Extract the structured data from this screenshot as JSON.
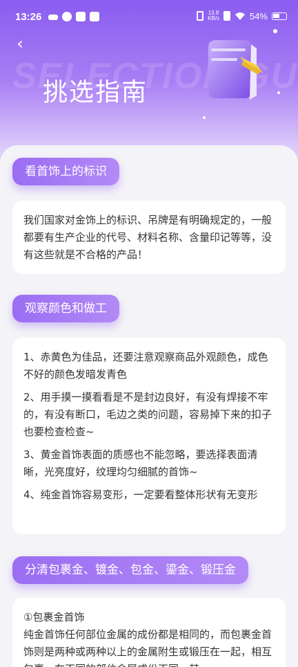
{
  "status": {
    "time": "13:26",
    "speed": "13.8",
    "speed_unit": "KB/s",
    "battery": "54%"
  },
  "header": {
    "back": "‹",
    "bg_word": "SELECTION GUIDE",
    "title": "挑选指南"
  },
  "sections": [
    {
      "tag": "看首饰上的标识",
      "paragraphs": [
        "我们国家对金饰上的标识、吊牌是有明确规定的，一般都要有生产企业的代号、材料名称、含量印记等等，没有这些就是不合格的产品！"
      ]
    },
    {
      "tag": "观察颜色和做工",
      "paragraphs": [
        "1、赤黄色为佳品，还要注意观察商品外观颜色，成色不好的颜色发暗发青色",
        "2、用手摸一摸看看是不是封边良好，有没有焊接不牢的，有没有断口，毛边之类的问题，容易掉下来的扣子也要检查检查~",
        "3、黄金首饰表面的质感也不能忽略，要选择表面清晰，光亮度好，纹理均匀细腻的首饰~",
        "4、纯金首饰容易变形，一定要看整体形状有无变形"
      ]
    },
    {
      "tag": "分清包裹金、镀金、包金、鎏金、锻压金",
      "paragraphs": [
        "①包裹金首饰",
        "纯金首饰任何部位金属的成份都是相同的，而包裹金首饰则是两种或两种以上的金属附生或锻压在一起，相互包裹，在不同的部位金属成份不同，其"
      ]
    }
  ],
  "colors": {
    "accent": "#8a5cf0",
    "tag_gradient_end": "#b38af6",
    "page_bg": "#f4f3f7"
  }
}
